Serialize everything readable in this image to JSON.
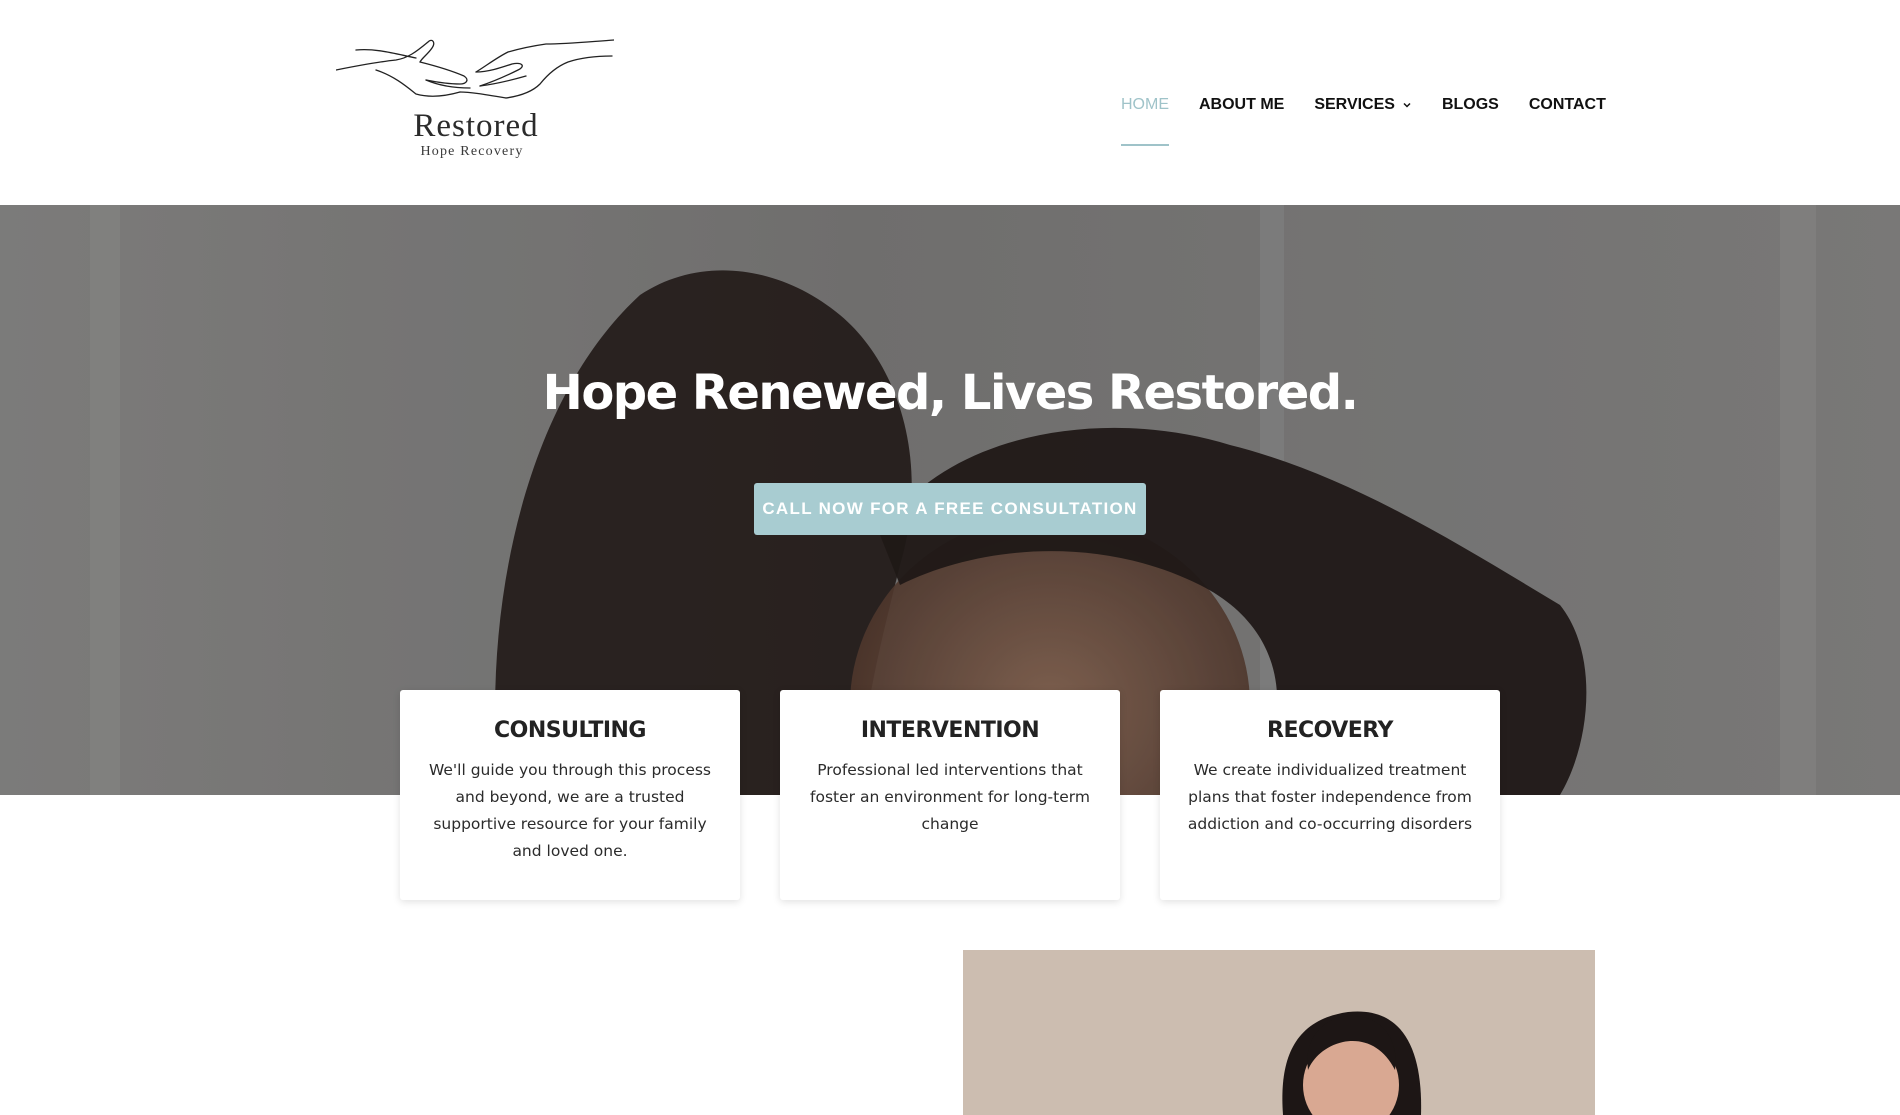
{
  "brand": {
    "name": "Restored",
    "tagline": "Hope Recovery"
  },
  "nav": {
    "items": [
      {
        "label": "HOME",
        "active": true
      },
      {
        "label": "ABOUT ME",
        "active": false
      },
      {
        "label": "SERVICES",
        "active": false,
        "has_dropdown": true
      },
      {
        "label": "BLOGS",
        "active": false
      },
      {
        "label": "CONTACT",
        "active": false
      }
    ]
  },
  "hero": {
    "title": "Hope Renewed, Lives Restored.",
    "cta_label": "CALL NOW FOR A FREE CONSULTATION"
  },
  "cards": [
    {
      "title": "CONSULTING",
      "text": "We'll guide you through this process and beyond, we are a trusted supportive resource for your family and loved one."
    },
    {
      "title": "INTERVENTION",
      "text": "Professional led interventions that foster an environment for long-term change"
    },
    {
      "title": "RECOVERY",
      "text": "We create individualized treatment plans that foster independence from addiction and co-occurring disorders"
    }
  ],
  "colors": {
    "accent": "#a8ccd1",
    "nav_active": "#9fc3c9",
    "text_dark": "#111111"
  },
  "icons": {
    "logo": "hands-reaching-icon",
    "dropdown": "chevron-down-icon"
  }
}
